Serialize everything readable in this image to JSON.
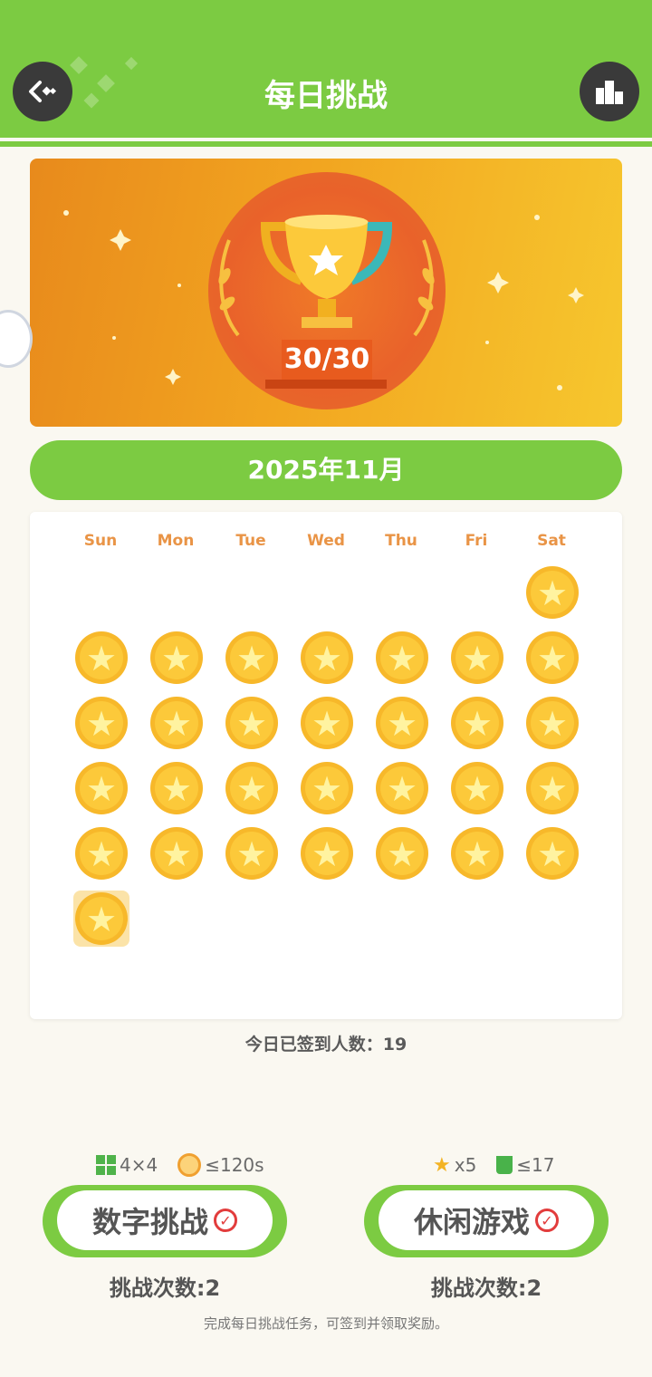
{
  "header": {
    "title": "每日挑战",
    "back_icon": "back-arrow-icon",
    "rank_icon": "podium-icon"
  },
  "banner": {
    "score": "30/30",
    "icon": "trophy-icon"
  },
  "calendar": {
    "month_label": "2025年11月",
    "weekdays": [
      "Sun",
      "Mon",
      "Tue",
      "Wed",
      "Thu",
      "Fri",
      "Sat"
    ],
    "completed_days": 30,
    "today": 30
  },
  "checkin_count": "今日已签到人数：19",
  "games": [
    {
      "label": "数字挑战",
      "tries": "挑战次数:2",
      "chips": [
        "4×4",
        "≤120s"
      ]
    },
    {
      "label": "休闲游戏",
      "tries": "挑战次数:2",
      "chips": [
        "x5",
        "≤17"
      ]
    }
  ],
  "footer": "完成每日挑战任务，可签到并领取奖励。",
  "colors": {
    "green": "#7ccb42",
    "orange": "#e99446",
    "gold": "#f7b82a",
    "red": "#e23c3c"
  }
}
